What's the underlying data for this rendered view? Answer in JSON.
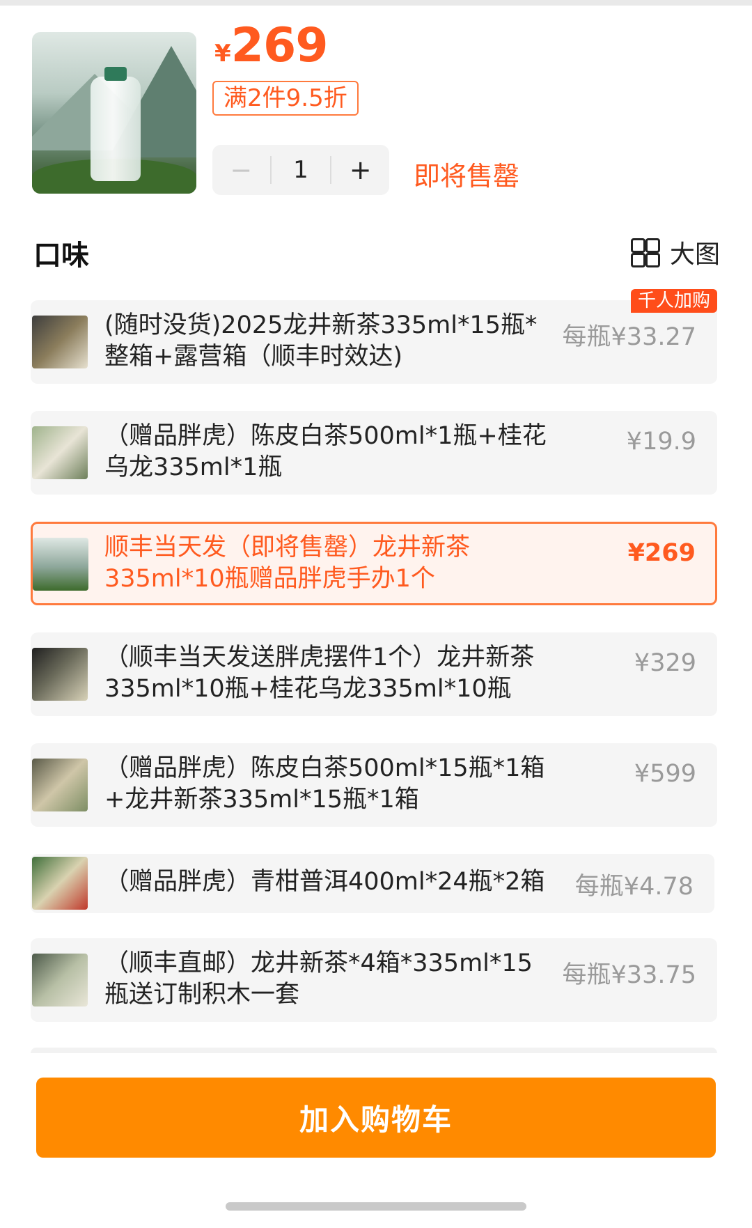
{
  "product": {
    "currency": "¥",
    "price": "269",
    "discount_label": "满2件9.5折",
    "quantity": "1",
    "minus_label": "−",
    "plus_label": "+",
    "status": "即将售罄"
  },
  "section": {
    "title": "口味",
    "big_view_label": "大图"
  },
  "options": [
    {
      "text": "(随时没货)2025龙井新茶335ml*15瓶*整箱+露营箱（顺丰时效达)",
      "price": "每瓶¥33.27",
      "tag": "千人加购",
      "selected": false
    },
    {
      "text": "（赠品胖虎）陈皮白茶500ml*1瓶+桂花乌龙335ml*1瓶",
      "price": "¥19.9",
      "tag": "",
      "selected": false
    },
    {
      "text": "顺丰当天发（即将售罄）龙井新茶335ml*10瓶赠品胖虎手办1个",
      "price": "¥269",
      "tag": "",
      "selected": true
    },
    {
      "text": "（顺丰当天发送胖虎摆件1个）龙井新茶335ml*10瓶+桂花乌龙335ml*10瓶",
      "price": "¥329",
      "tag": "",
      "selected": false
    },
    {
      "text": "（赠品胖虎）陈皮白茶500ml*15瓶*1箱+龙井新茶335ml*15瓶*1箱",
      "price": "¥599",
      "tag": "",
      "selected": false
    },
    {
      "text": "（赠品胖虎）青柑普洱400ml*24瓶*2箱",
      "price": "每瓶¥4.78",
      "tag": "",
      "selected": false
    },
    {
      "text": "（顺丰直邮）龙井新茶*4箱*335ml*15瓶送订制积木一套",
      "price": "每瓶¥33.75",
      "tag": "",
      "selected": false
    }
  ],
  "cart_button_label": "加入购物车",
  "colors": {
    "accent": "#ff5a1f",
    "button": "#ff8a00"
  }
}
